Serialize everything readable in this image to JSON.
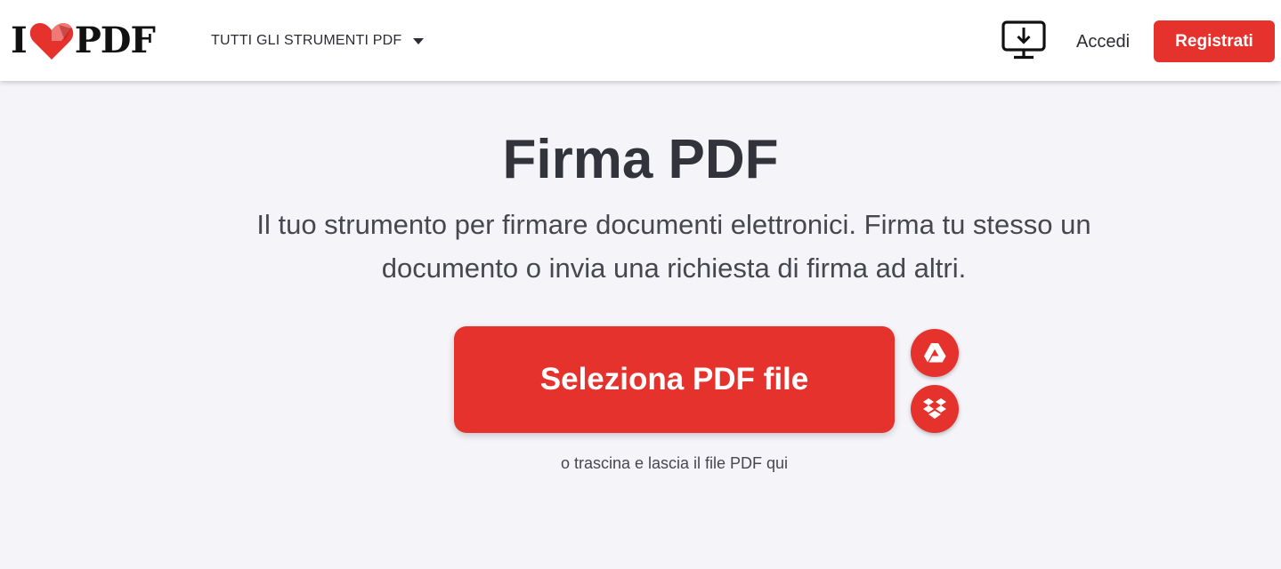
{
  "header": {
    "logo": {
      "left": "I",
      "right": "PDF",
      "brand_color": "#e5322d"
    },
    "tools_menu_label": "TUTTI GLI STRUMENTI PDF",
    "desktop_icon": "desktop-download-icon",
    "login_label": "Accedi",
    "register_label": "Registrati"
  },
  "main": {
    "title": "Firma PDF",
    "subtitle": "Il tuo strumento per firmare documenti elettronici. Firma tu stesso un documento o invia una richiesta di firma ad altri.",
    "select_button_label": "Seleziona PDF file",
    "cloud_buttons": [
      {
        "icon": "google-drive-icon"
      },
      {
        "icon": "dropbox-icon"
      }
    ],
    "drop_hint": "o trascina e lascia il file PDF qui"
  },
  "colors": {
    "accent": "#e5322d",
    "background": "#f4f4f9",
    "header_bg": "#ffffff",
    "text_dark": "#33333b"
  }
}
